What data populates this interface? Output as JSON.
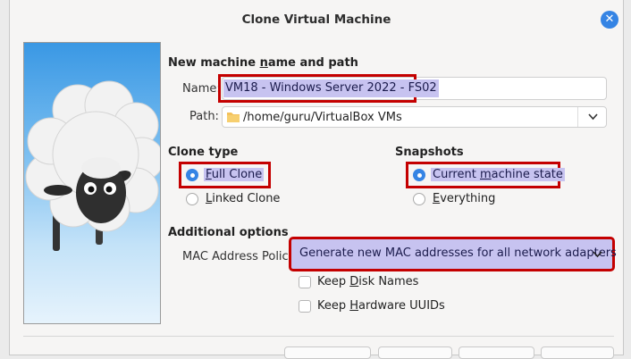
{
  "window": {
    "title": "Clone Virtual Machine",
    "close_icon": "close-icon"
  },
  "banner": {
    "image": "sheep-illustration"
  },
  "name_path": {
    "heading_pre": "New machine ",
    "heading_u": "n",
    "heading_post": "ame and path",
    "name_label": "Name:",
    "name_value": "VM18 - Windows Server 2022 - FS02",
    "path_label": "Path:",
    "path_value": "/home/guru/VirtualBox VMs",
    "path_icon": "folder-icon"
  },
  "clone_type": {
    "heading": "Clone type",
    "options": [
      {
        "u": "F",
        "rest": "ull Clone",
        "selected": true
      },
      {
        "u": "L",
        "rest": "inked Clone",
        "selected": false
      }
    ]
  },
  "snapshots": {
    "heading": "Snapshots",
    "options": [
      {
        "pre": "Current ",
        "u": "m",
        "rest": "achine state",
        "selected": true
      },
      {
        "pre": "",
        "u": "E",
        "rest": "verything",
        "selected": false
      }
    ]
  },
  "additional": {
    "heading": "Additional options",
    "mac_label": "MAC Address Policy:",
    "mac_value": "Generate new MAC addresses for all network adapters",
    "keep_disk": {
      "pre": "Keep ",
      "u": "D",
      "rest": "isk Names",
      "checked": false
    },
    "keep_hw": {
      "pre": "Keep ",
      "u": "H",
      "rest": "ardware UUIDs",
      "checked": false
    }
  },
  "colors": {
    "accent": "#3584e4",
    "highlight": "#c40000",
    "selection": "#c7c3f0"
  }
}
